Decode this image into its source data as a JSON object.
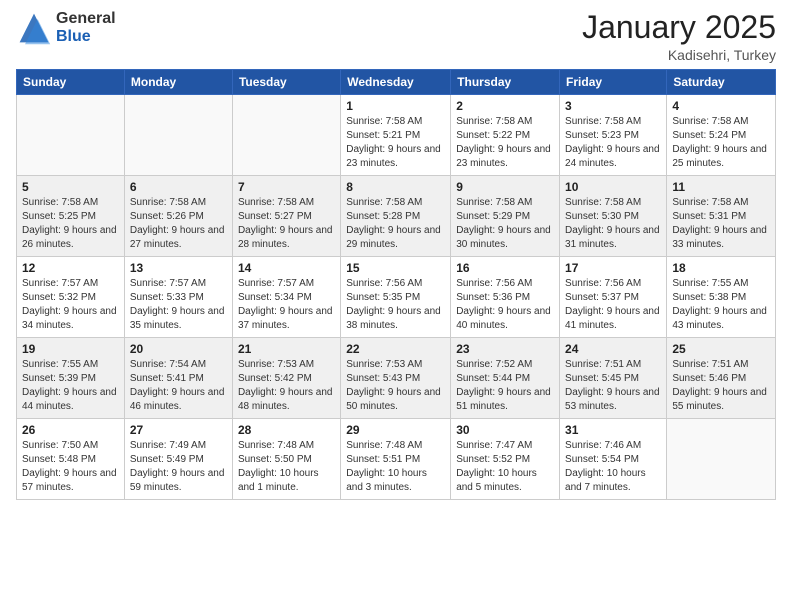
{
  "header": {
    "logo_line1": "General",
    "logo_line2": "Blue",
    "month": "January 2025",
    "location": "Kadisehri, Turkey"
  },
  "weekdays": [
    "Sunday",
    "Monday",
    "Tuesday",
    "Wednesday",
    "Thursday",
    "Friday",
    "Saturday"
  ],
  "weeks": [
    [
      {
        "day": "",
        "info": ""
      },
      {
        "day": "",
        "info": ""
      },
      {
        "day": "",
        "info": ""
      },
      {
        "day": "1",
        "info": "Sunrise: 7:58 AM\nSunset: 5:21 PM\nDaylight: 9 hours and 23 minutes."
      },
      {
        "day": "2",
        "info": "Sunrise: 7:58 AM\nSunset: 5:22 PM\nDaylight: 9 hours and 23 minutes."
      },
      {
        "day": "3",
        "info": "Sunrise: 7:58 AM\nSunset: 5:23 PM\nDaylight: 9 hours and 24 minutes."
      },
      {
        "day": "4",
        "info": "Sunrise: 7:58 AM\nSunset: 5:24 PM\nDaylight: 9 hours and 25 minutes."
      }
    ],
    [
      {
        "day": "5",
        "info": "Sunrise: 7:58 AM\nSunset: 5:25 PM\nDaylight: 9 hours and 26 minutes."
      },
      {
        "day": "6",
        "info": "Sunrise: 7:58 AM\nSunset: 5:26 PM\nDaylight: 9 hours and 27 minutes."
      },
      {
        "day": "7",
        "info": "Sunrise: 7:58 AM\nSunset: 5:27 PM\nDaylight: 9 hours and 28 minutes."
      },
      {
        "day": "8",
        "info": "Sunrise: 7:58 AM\nSunset: 5:28 PM\nDaylight: 9 hours and 29 minutes."
      },
      {
        "day": "9",
        "info": "Sunrise: 7:58 AM\nSunset: 5:29 PM\nDaylight: 9 hours and 30 minutes."
      },
      {
        "day": "10",
        "info": "Sunrise: 7:58 AM\nSunset: 5:30 PM\nDaylight: 9 hours and 31 minutes."
      },
      {
        "day": "11",
        "info": "Sunrise: 7:58 AM\nSunset: 5:31 PM\nDaylight: 9 hours and 33 minutes."
      }
    ],
    [
      {
        "day": "12",
        "info": "Sunrise: 7:57 AM\nSunset: 5:32 PM\nDaylight: 9 hours and 34 minutes."
      },
      {
        "day": "13",
        "info": "Sunrise: 7:57 AM\nSunset: 5:33 PM\nDaylight: 9 hours and 35 minutes."
      },
      {
        "day": "14",
        "info": "Sunrise: 7:57 AM\nSunset: 5:34 PM\nDaylight: 9 hours and 37 minutes."
      },
      {
        "day": "15",
        "info": "Sunrise: 7:56 AM\nSunset: 5:35 PM\nDaylight: 9 hours and 38 minutes."
      },
      {
        "day": "16",
        "info": "Sunrise: 7:56 AM\nSunset: 5:36 PM\nDaylight: 9 hours and 40 minutes."
      },
      {
        "day": "17",
        "info": "Sunrise: 7:56 AM\nSunset: 5:37 PM\nDaylight: 9 hours and 41 minutes."
      },
      {
        "day": "18",
        "info": "Sunrise: 7:55 AM\nSunset: 5:38 PM\nDaylight: 9 hours and 43 minutes."
      }
    ],
    [
      {
        "day": "19",
        "info": "Sunrise: 7:55 AM\nSunset: 5:39 PM\nDaylight: 9 hours and 44 minutes."
      },
      {
        "day": "20",
        "info": "Sunrise: 7:54 AM\nSunset: 5:41 PM\nDaylight: 9 hours and 46 minutes."
      },
      {
        "day": "21",
        "info": "Sunrise: 7:53 AM\nSunset: 5:42 PM\nDaylight: 9 hours and 48 minutes."
      },
      {
        "day": "22",
        "info": "Sunrise: 7:53 AM\nSunset: 5:43 PM\nDaylight: 9 hours and 50 minutes."
      },
      {
        "day": "23",
        "info": "Sunrise: 7:52 AM\nSunset: 5:44 PM\nDaylight: 9 hours and 51 minutes."
      },
      {
        "day": "24",
        "info": "Sunrise: 7:51 AM\nSunset: 5:45 PM\nDaylight: 9 hours and 53 minutes."
      },
      {
        "day": "25",
        "info": "Sunrise: 7:51 AM\nSunset: 5:46 PM\nDaylight: 9 hours and 55 minutes."
      }
    ],
    [
      {
        "day": "26",
        "info": "Sunrise: 7:50 AM\nSunset: 5:48 PM\nDaylight: 9 hours and 57 minutes."
      },
      {
        "day": "27",
        "info": "Sunrise: 7:49 AM\nSunset: 5:49 PM\nDaylight: 9 hours and 59 minutes."
      },
      {
        "day": "28",
        "info": "Sunrise: 7:48 AM\nSunset: 5:50 PM\nDaylight: 10 hours and 1 minute."
      },
      {
        "day": "29",
        "info": "Sunrise: 7:48 AM\nSunset: 5:51 PM\nDaylight: 10 hours and 3 minutes."
      },
      {
        "day": "30",
        "info": "Sunrise: 7:47 AM\nSunset: 5:52 PM\nDaylight: 10 hours and 5 minutes."
      },
      {
        "day": "31",
        "info": "Sunrise: 7:46 AM\nSunset: 5:54 PM\nDaylight: 10 hours and 7 minutes."
      },
      {
        "day": "",
        "info": ""
      }
    ]
  ]
}
